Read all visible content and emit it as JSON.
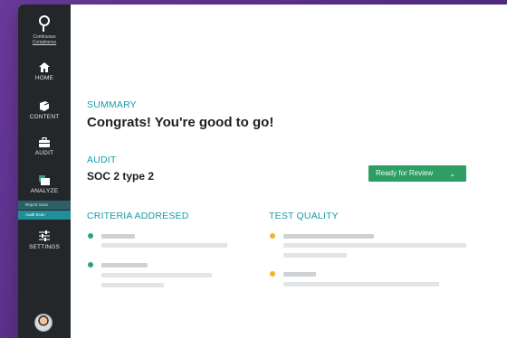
{
  "sidebar": {
    "logo_line1": "Continuous",
    "logo_line2": "Compliance",
    "items": [
      {
        "label": "HOME",
        "icon": "home-icon"
      },
      {
        "label": "CONTENT",
        "icon": "content-icon"
      },
      {
        "label": "AUDIT",
        "icon": "briefcase-icon"
      },
      {
        "label": "ANALYZE",
        "icon": "analyze-icon"
      },
      {
        "label": "SETTINGS",
        "icon": "settings-sliders-icon"
      }
    ],
    "subitems": [
      "Report Scan",
      "Audit Scan"
    ]
  },
  "summary": {
    "label": "SUMMARY",
    "title": "Congrats! You're good to go!"
  },
  "audit": {
    "label": "AUDIT",
    "name": "SOC 2 type 2",
    "status": "Ready for Review"
  },
  "criteria": {
    "label": "CRITERIA ADDRESED",
    "status_color": "#2aa56f"
  },
  "test_quality": {
    "label": "TEST QUALITY",
    "status_color": "#f0b429"
  },
  "colors": {
    "accent": "#1a9ba8",
    "sidebar": "#24272a",
    "badge": "#2f9e64"
  }
}
